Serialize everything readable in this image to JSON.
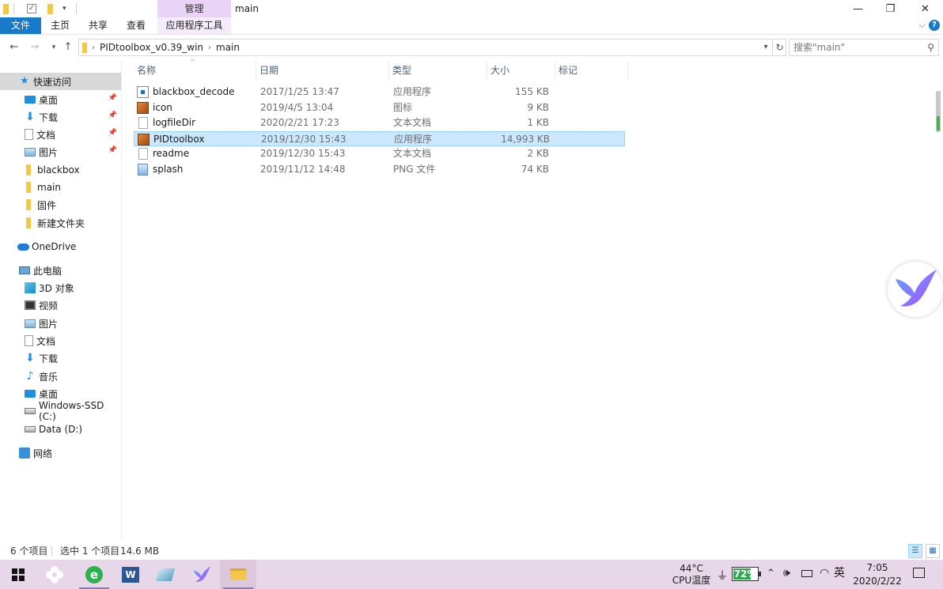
{
  "window": {
    "title": "main",
    "contextual_tab_group": "管理",
    "controls": {
      "minimize": "—",
      "maximize": "❐",
      "close": "✕"
    }
  },
  "ribbon": {
    "tabs": [
      {
        "label": "文件"
      },
      {
        "label": "主页"
      },
      {
        "label": "共享"
      },
      {
        "label": "查看"
      },
      {
        "label": "应用程序工具"
      }
    ],
    "help": "?"
  },
  "address": {
    "crumbs": [
      "PIDtoolbox_v0.39_win",
      "main"
    ],
    "search_placeholder": "搜索\"main\""
  },
  "nav_pane": {
    "quick_access": "快速访问",
    "quick_items": [
      "桌面",
      "下载",
      "文档",
      "图片",
      "blackbox",
      "main",
      "固件",
      "新建文件夹"
    ],
    "onedrive": "OneDrive",
    "this_pc": "此电脑",
    "pc_items": [
      "3D 对象",
      "视频",
      "图片",
      "文档",
      "下载",
      "音乐",
      "桌面",
      "Windows-SSD (C:)",
      "Data (D:)"
    ],
    "network": "网络"
  },
  "columns": {
    "name": "名称",
    "date": "日期",
    "type": "类型",
    "size": "大小",
    "tags": "标记"
  },
  "files": [
    {
      "name": "blackbox_decode",
      "date": "2017/1/25 13:47",
      "type": "应用程序",
      "size": "155 KB",
      "icon": "exe-icon"
    },
    {
      "name": "icon",
      "date": "2019/4/5 13:04",
      "type": "图标",
      "size": "9 KB",
      "icon": "pid-icon"
    },
    {
      "name": "logfileDir",
      "date": "2020/2/21 17:23",
      "type": "文本文档",
      "size": "1 KB",
      "icon": "text-file-icon"
    },
    {
      "name": "PIDtoolbox",
      "date": "2019/12/30 15:43",
      "type": "应用程序",
      "size": "14,993 KB",
      "icon": "pid-icon",
      "selected": true
    },
    {
      "name": "readme",
      "date": "2019/12/30 15:43",
      "type": "文本文档",
      "size": "2 KB",
      "icon": "text-file-icon"
    },
    {
      "name": "splash",
      "date": "2019/11/12 14:48",
      "type": "PNG 文件",
      "size": "74 KB",
      "icon": "image-file-icon"
    }
  ],
  "status": {
    "item_count": "6 个项目",
    "selected": "选中 1 个项目",
    "selected_size": "14.6 MB"
  },
  "taskbar": {
    "temp": "44°C",
    "temp_label": "CPU温度",
    "battery": "72%",
    "battery_level": 0.72,
    "ime": "英",
    "time": "7:05",
    "date": "2020/2/22"
  }
}
